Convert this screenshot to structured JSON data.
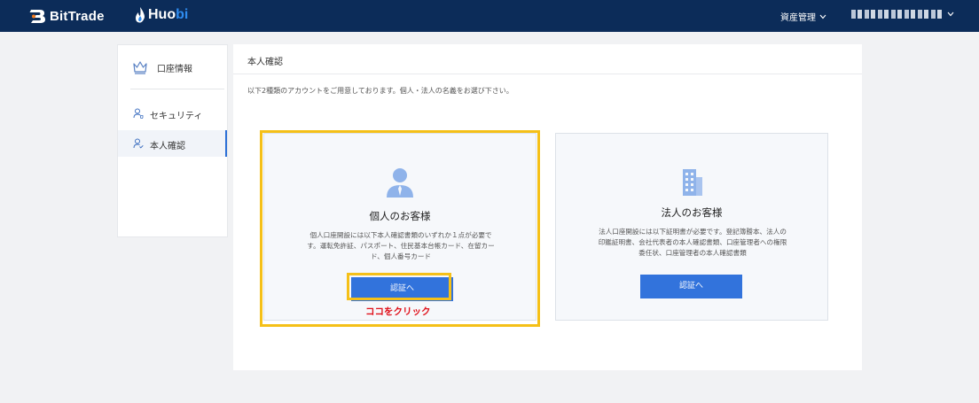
{
  "header": {
    "brand_bittrade": "BitTrade",
    "brand_huobi_a": "Huo",
    "brand_huobi_b": "bi",
    "asset_menu_label": "資産管理"
  },
  "sidebar": {
    "account_info_label": "口座情報",
    "items": [
      {
        "label": "セキュリティ",
        "icon": "user-shield-icon"
      },
      {
        "label": "本人確認",
        "icon": "user-check-icon"
      }
    ]
  },
  "main": {
    "title": "本人確認",
    "description": "以下2種類のアカウントをご用意しております。個人・法人の名義をお選び下さい。",
    "cards": [
      {
        "title": "個人のお客様",
        "body_lines": [
          "個人口座開設には以下本人確認書類のいずれか１点が必要で",
          "す。運転免許証、パスポート、住民基本台帳カード、在留カー",
          "ド、個人番号カード"
        ],
        "button_label": "認証へ",
        "icon": "person-icon"
      },
      {
        "title": "法人のお客様",
        "body_lines": [
          "法人口座開設には以下証明書が必要です。登記簿謄本、法人の",
          "印鑑証明書、会社代表者の本人確認書類、口座管理者への権限",
          "委任状、口座管理者の本人確認書類"
        ],
        "button_label": "認証へ",
        "icon": "building-icon"
      }
    ]
  },
  "annotation": {
    "click_here": "ココをクリック",
    "highlight_color": "#f5c018",
    "note_color": "#e0101a"
  },
  "colors": {
    "header_bg": "#0c2c59",
    "primary_button": "#3273dc",
    "active_indicator": "#2b6fd6"
  }
}
